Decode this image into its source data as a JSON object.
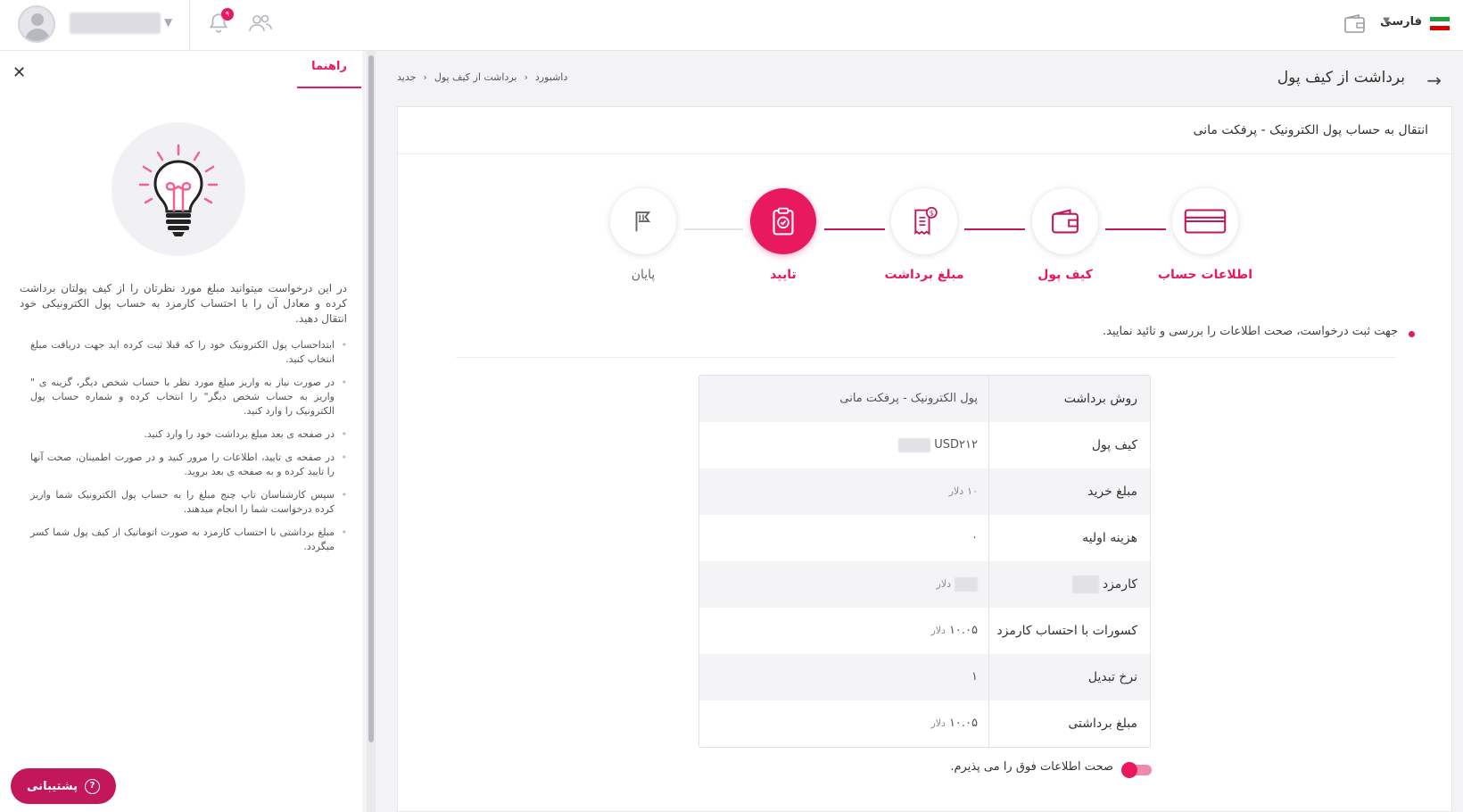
{
  "header": {
    "notification_count": "۹",
    "language": "فارسی"
  },
  "help": {
    "tab": "راهنما",
    "intro": "در این درخواست میتوانید مبلغ مورد نظرتان را از کیف پولتان برداشت کرده و معادل آن را با احتساب کارمزد به حساب پول الکترونیکی خود انتقال دهید.",
    "items": [
      "ابتداحساب پول الکترونیک خود را که قبلا ثبت کرده اید جهت دریافت مبلغ انتخاب کنید.",
      "در صورت نیاز به واریز مبلغ مورد نظر با حساب شخص دیگر، گزینه ی \" واریز به حساب شخص دیگر\" را انتخاب کرده و شماره حساب پول الکترونیک  را وارد کنید.",
      "در صفحه ی بعد مبلغ برداشت خود را وارد کنید.",
      "در صفحه ی تایید، اطلاعات را مرور کنید و در صورت اطمینان، صحت آنها را تایید کرده و به صفحه ی بعد بروید.",
      "سپس کارشناسان تاپ چنج مبلغ را به حساب پول الکترونیک شما واریز کرده درخواست شما را انجام میدهند.",
      "مبلغ برداشتی با احتساب کارمزد به صورت اتوماتیک از کیف پول شما کسر میگردد."
    ],
    "support_label": "پشتیبانی"
  },
  "page": {
    "title": "برداشت از کیف پول",
    "breadcrumb": [
      "داشبورد",
      "برداشت از کیف پول",
      "جدید"
    ],
    "card_title": "انتقال به حساب پول الکترونیک - پرفکت مانی",
    "steps": [
      {
        "label": "اطلاعات حساب",
        "icon": "card-icon",
        "state": "done"
      },
      {
        "label": "کیف پول",
        "icon": "wallet-icon",
        "state": "done"
      },
      {
        "label": "مبلغ برداشت",
        "icon": "invoice-icon",
        "state": "done"
      },
      {
        "label": "تایید",
        "icon": "clipboard-check-icon",
        "state": "active"
      },
      {
        "label": "پایان",
        "icon": "flag-icon",
        "state": "pending"
      }
    ],
    "notice": "جهت ثبت درخواست، صحت اطلاعات را بررسی و تائید نمایید.",
    "rows": [
      {
        "key": "روش برداشت",
        "value": "پول الکترونیک - پرفکت مانی"
      },
      {
        "key": "کیف پول",
        "value": "USD۲۱۲"
      },
      {
        "key": "مبلغ خرید",
        "value": "۱۰",
        "unit": "دلار"
      },
      {
        "key": "هزینه اولیه",
        "value": "۰"
      },
      {
        "key": "کارمزد",
        "value": "",
        "unit": "دلار"
      },
      {
        "key": "کسورات با احتساب کارمزد",
        "value": "۱۰.۰۵",
        "unit": "دلار"
      },
      {
        "key": "نرخ تبدیل",
        "value": "۱"
      },
      {
        "key": "مبلغ برداشتی",
        "value": "۱۰.۰۵",
        "unit": "دلار"
      }
    ],
    "accept_label": "صحت اطلاعات فوق را می پذیرم."
  },
  "colors": {
    "accent": "#e8195f",
    "accent_dark": "#c2185b"
  }
}
